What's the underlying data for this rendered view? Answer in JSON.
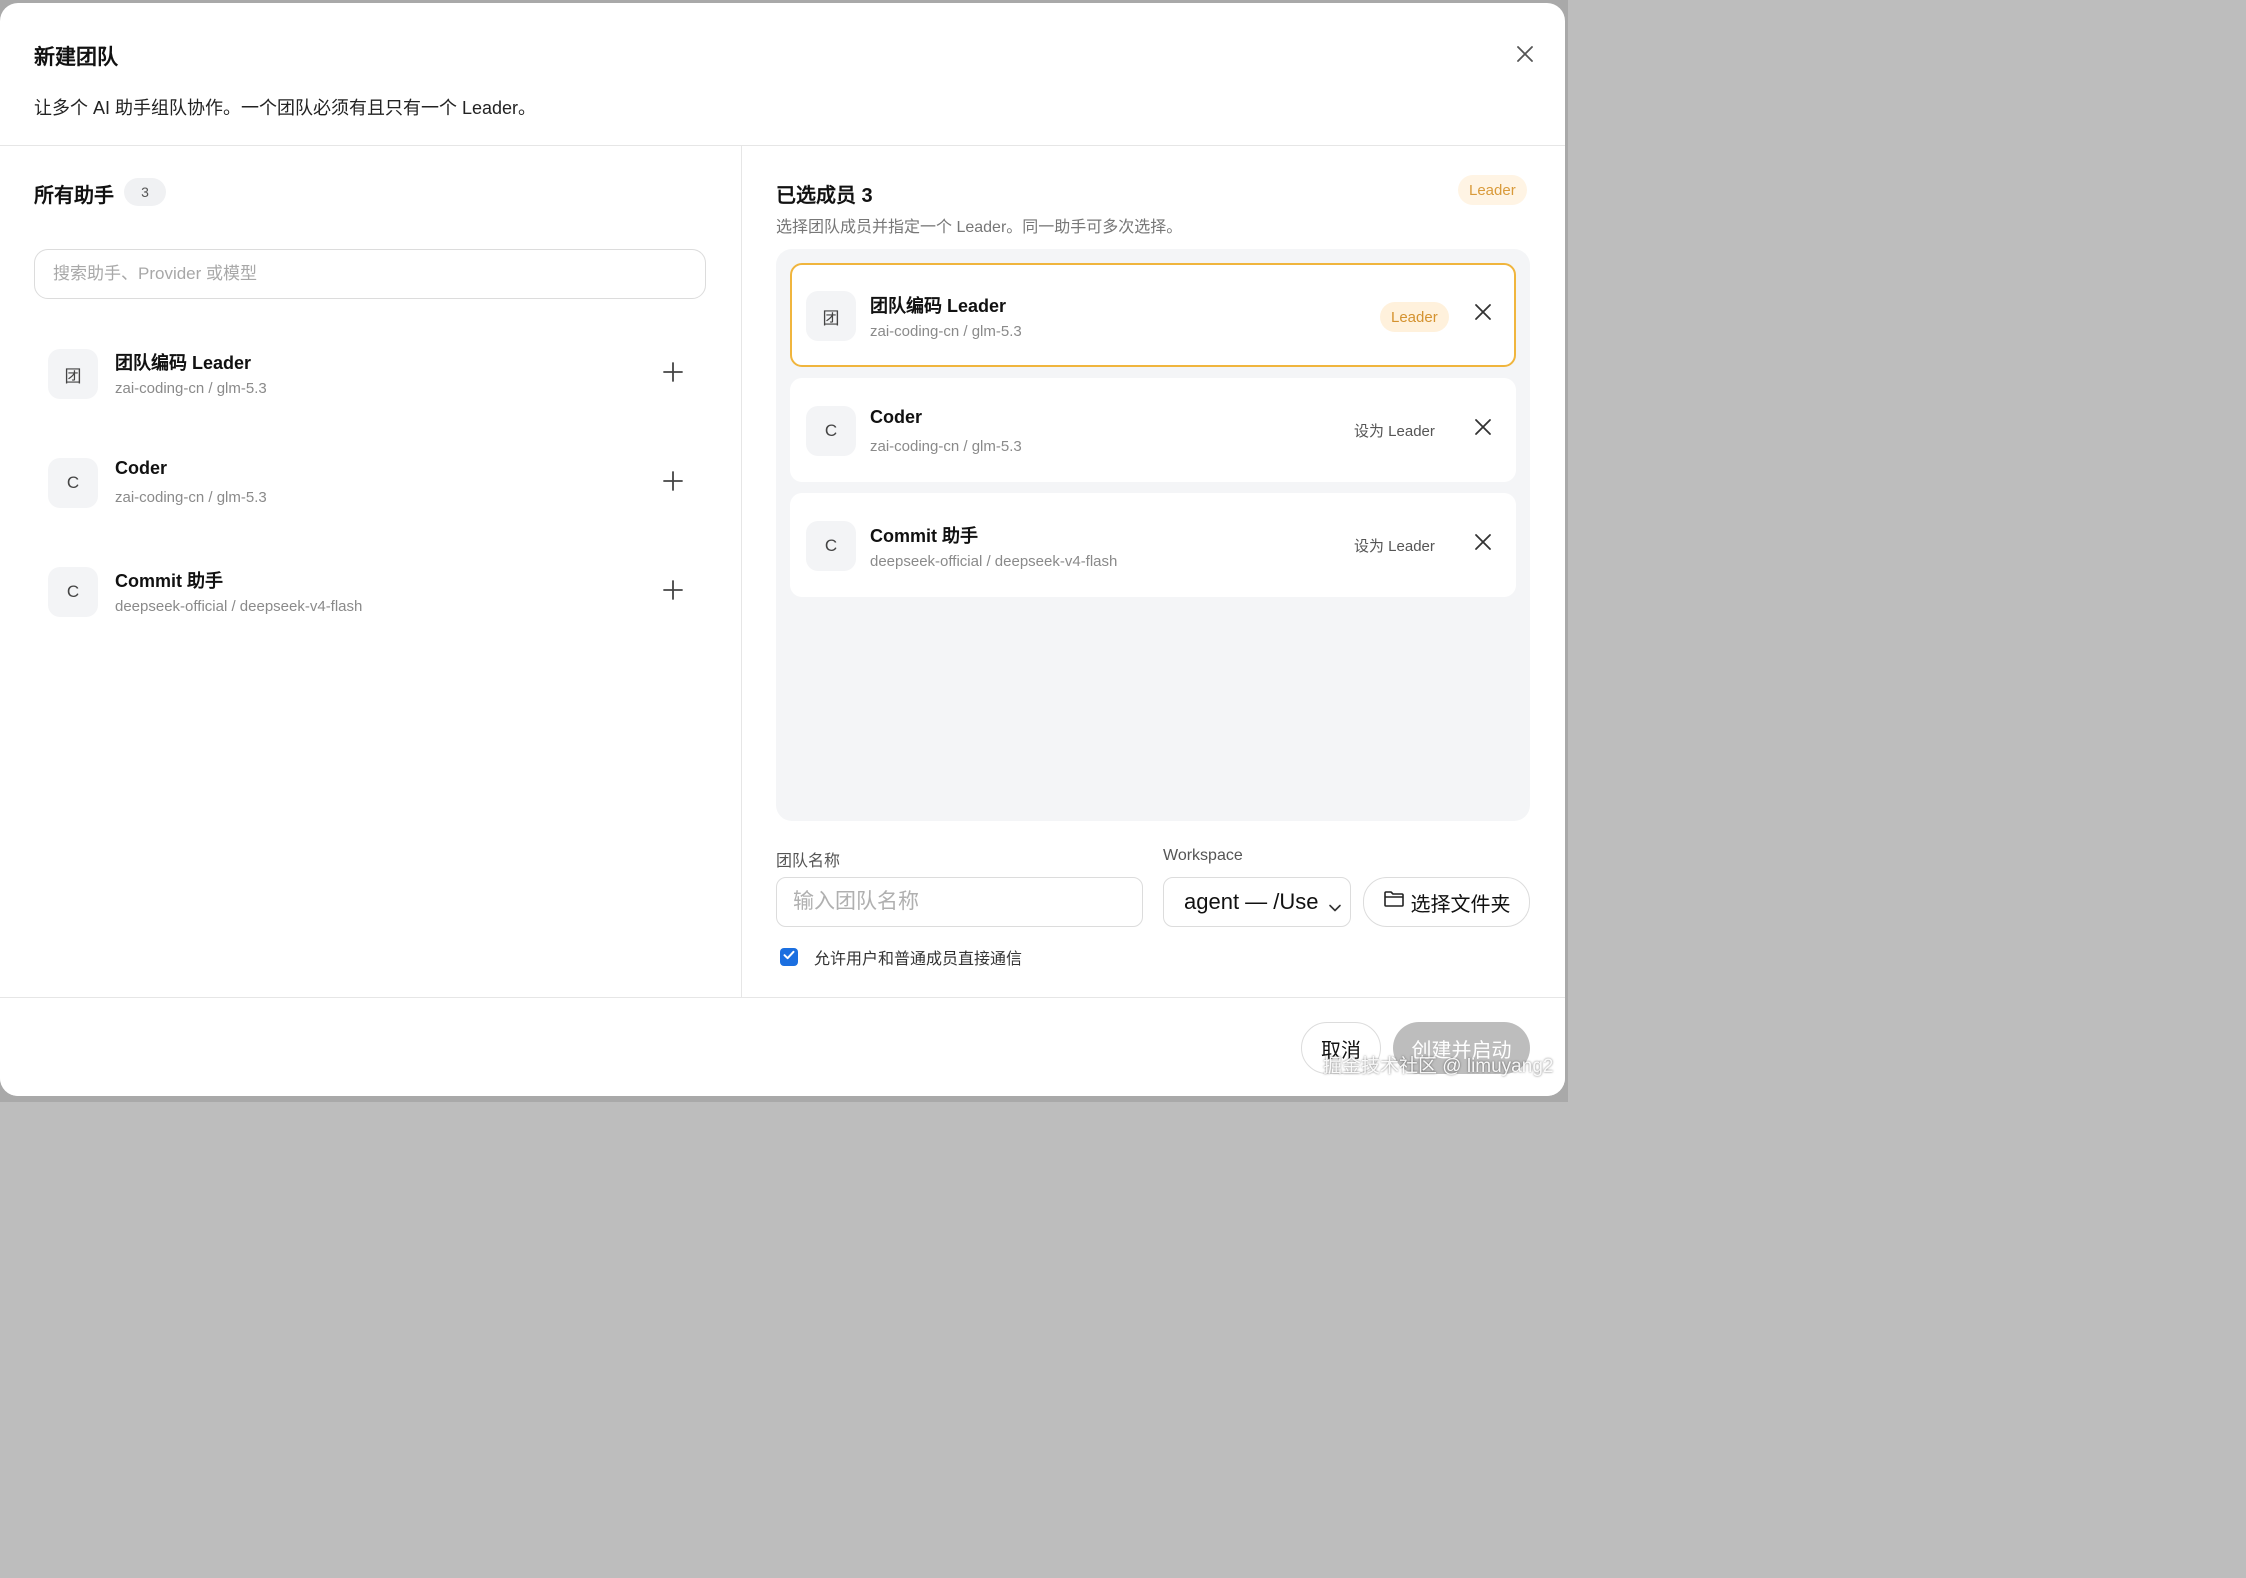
{
  "dialog": {
    "title": "新建团队",
    "description": "让多个 AI 助手组队协作。一个团队必须有且只有一个 Leader。"
  },
  "left": {
    "title": "所有助手",
    "count": "3",
    "search_placeholder": "搜索助手、Provider 或模型",
    "assistants": [
      {
        "avatar": "团",
        "name": "团队编码 Leader",
        "sub": "zai-coding-cn / glm-5.3"
      },
      {
        "avatar": "C",
        "name": "Coder",
        "sub": "zai-coding-cn / glm-5.3"
      },
      {
        "avatar": "C",
        "name": "Commit 助手",
        "sub": "deepseek-official / deepseek-v4-flash"
      }
    ]
  },
  "right": {
    "title": "已选成员 3",
    "leader_tag": "Leader",
    "description": "选择团队成员并指定一个 Leader。同一助手可多次选择。",
    "members": [
      {
        "avatar": "团",
        "name": "团队编码 Leader",
        "sub": "zai-coding-cn / glm-5.3",
        "is_leader": true,
        "badge": "Leader"
      },
      {
        "avatar": "C",
        "name": "Coder",
        "sub": "zai-coding-cn / glm-5.3",
        "is_leader": false,
        "action": "设为 Leader"
      },
      {
        "avatar": "C",
        "name": "Commit 助手",
        "sub": "deepseek-official / deepseek-v4-flash",
        "is_leader": false,
        "action": "设为 Leader"
      }
    ],
    "team_name_label": "团队名称",
    "team_name_placeholder": "输入团队名称",
    "team_name_value": "",
    "workspace_label": "Workspace",
    "workspace_value": "agent — /Use",
    "folder_button": "选择文件夹",
    "allow_direct_label": "允许用户和普通成员直接通信",
    "allow_direct_checked": true
  },
  "footer": {
    "cancel": "取消",
    "create": "创建并启动"
  },
  "watermark": "掘金技术社区 @ limuyang2",
  "icons": {
    "close": "close-icon",
    "add": "plus-icon",
    "remove": "x-icon",
    "folder": "folder-icon",
    "chevron": "chevron-down-icon",
    "check": "check-icon"
  },
  "colors": {
    "leader_accent": "#f0b53d",
    "leader_text": "#d4922f",
    "checkbox": "#1b6fe0",
    "primary_disabled": "#bdbdbd"
  }
}
